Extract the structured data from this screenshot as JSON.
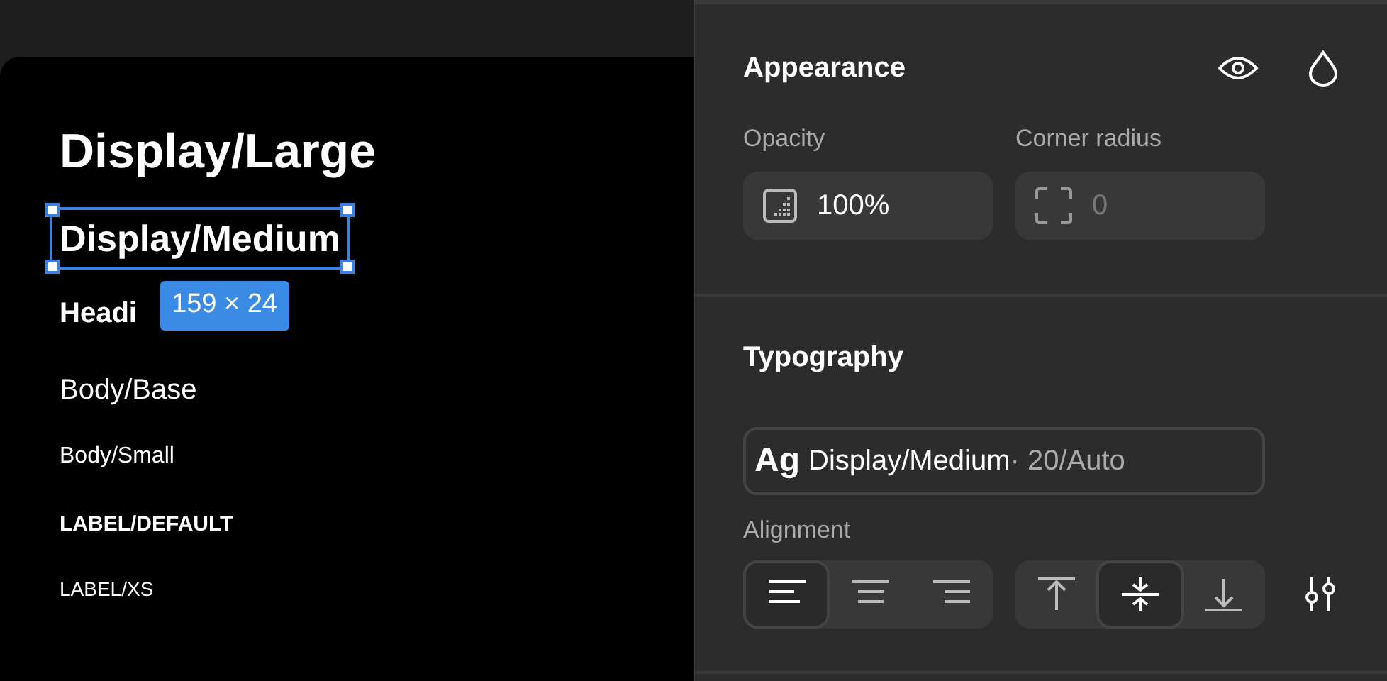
{
  "canvas": {
    "styles": [
      {
        "text": "Display/Large",
        "kind": "display-large",
        "selected": false
      },
      {
        "text": "Display/Medium",
        "kind": "display-medium",
        "selected": true
      },
      {
        "text": "Headi",
        "kind": "heading",
        "selected": false
      },
      {
        "text": "Body/Base",
        "kind": "body",
        "selected": false
      },
      {
        "text": "Body/Small",
        "kind": "body-small",
        "selected": false
      },
      {
        "text": "LABEL/DEFAULT",
        "kind": "label",
        "selected": false
      },
      {
        "text": "LABEL/XS",
        "kind": "label-xs",
        "selected": false
      }
    ],
    "size_label": "159 × 24"
  },
  "panel": {
    "appearance": {
      "title": "Appearance",
      "fields": [
        {
          "label": "Opacity",
          "value": "100%",
          "kind": "opacity",
          "disabled": false
        },
        {
          "label": "Corner radius",
          "value": "0",
          "kind": "radius",
          "disabled": true
        }
      ]
    },
    "typography": {
      "title": "Typography",
      "style": {
        "sample": "Ag",
        "name": "Display/Medium",
        "detail": "· 20/Auto"
      },
      "alignment_label": "Alignment",
      "horizontal": [
        {
          "kind": "left",
          "selected": true
        },
        {
          "kind": "center",
          "selected": false
        },
        {
          "kind": "right",
          "selected": false
        }
      ],
      "vertical": [
        {
          "kind": "top",
          "selected": false
        },
        {
          "kind": "middle",
          "selected": true
        },
        {
          "kind": "bottom",
          "selected": false
        }
      ]
    }
  }
}
